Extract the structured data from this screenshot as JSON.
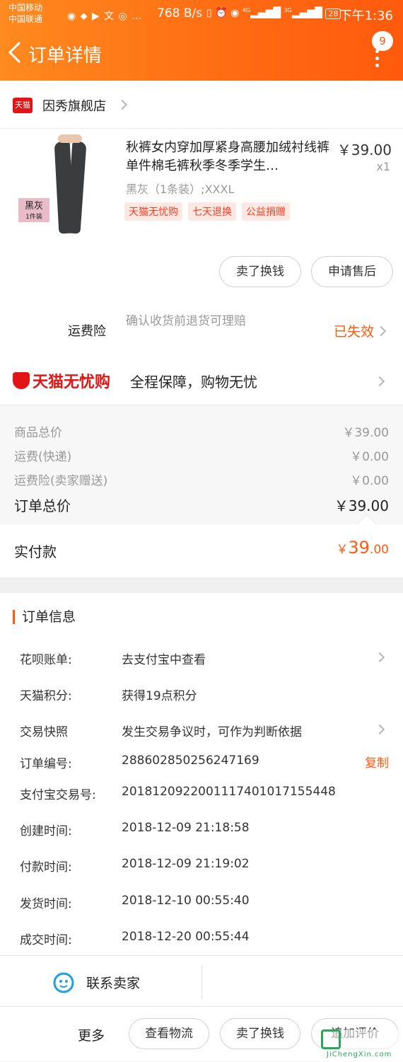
{
  "status_bar": {
    "carrier1": "中国移动",
    "carrier2": "中国联通",
    "speed": "768 B/s",
    "signal1": "4G",
    "signal2": "3G",
    "battery": "28",
    "time": "下午1:36"
  },
  "header": {
    "title": "订单详情",
    "badge_count": "9",
    "accent": "#ff6a12"
  },
  "shop": {
    "logo": "天猫",
    "name": "因秀旗舰店"
  },
  "product": {
    "title": "秋裤女内穿加厚紧身高腰加绒衬线裤单件棉毛裤秋季冬季学生…",
    "price": "￥39.00",
    "qty": "x1",
    "sku": "黑灰（1条装）;XXXL",
    "img_tag": "黑灰",
    "img_tag_sub": "1件装",
    "chips": [
      "天猫无忧购",
      "七天退换",
      "公益捐赠"
    ],
    "btn_sell": "卖了换钱",
    "btn_after_sale": "申请售后"
  },
  "insurance": {
    "label": "运费险",
    "desc": "确认收货前退货可理赔",
    "status": "已失效"
  },
  "wuyou": {
    "brand": "天猫无忧购",
    "desc": "全程保障，购物无忧"
  },
  "summary": {
    "rows": [
      {
        "label": "商品总价",
        "value": "￥39.00"
      },
      {
        "label": "运费(快递)",
        "value": "￥0.00"
      },
      {
        "label": "运费险(卖家赠送)",
        "value": "￥0.00"
      }
    ],
    "total_label": "订单总价",
    "total_value": "￥39.00",
    "paid_label": "实付款",
    "paid_currency": "￥",
    "paid_int": "39",
    "paid_dec": ".00"
  },
  "order_info": {
    "title": "订单信息",
    "rows": [
      {
        "k": "花呗账单:",
        "v": "去支付宝中查看"
      },
      {
        "k": "天猫积分:",
        "v": "获得19点积分"
      },
      {
        "k": "交易快照",
        "v": "发生交易争议时，可作为判断依据"
      },
      {
        "k": "订单编号:",
        "v": "288602850256247169"
      },
      {
        "k": "支付宝交易号:",
        "v": "2018120922001117401017155448"
      },
      {
        "k": "创建时间:",
        "v": "2018-12-09 21:18:58"
      },
      {
        "k": "付款时间:",
        "v": "2018-12-09 21:19:02"
      },
      {
        "k": "发货时间:",
        "v": "2018-12-10 00:55:40"
      },
      {
        "k": "成交时间:",
        "v": "2018-12-20 00:55:44"
      }
    ],
    "copy": "复制"
  },
  "contact": {
    "label": "联系卖家"
  },
  "bottom_bar": {
    "more": "更多",
    "logistics": "查看物流",
    "sell": "卖了换钱",
    "review": "追加评价"
  },
  "watermark": {
    "text": "JiChengXin.com"
  }
}
